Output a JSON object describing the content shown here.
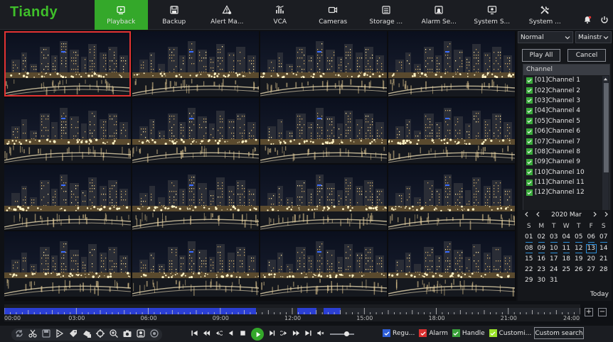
{
  "brand": {
    "logo": "Tiandy",
    "accent": "#34a82a",
    "logo_color": "#3fbf2a"
  },
  "nav": [
    {
      "label": "Playback",
      "icon": "playback-icon",
      "active": true
    },
    {
      "label": "Backup",
      "icon": "backup-icon"
    },
    {
      "label": "Alert Ma...",
      "icon": "alert-icon"
    },
    {
      "label": "VCA",
      "icon": "vca-icon"
    },
    {
      "label": "Cameras",
      "icon": "camera-icon"
    },
    {
      "label": "Storage ...",
      "icon": "storage-icon"
    },
    {
      "label": "Alarm Se...",
      "icon": "alarm-icon"
    },
    {
      "label": "System S...",
      "icon": "system-status-icon"
    },
    {
      "label": "System ...",
      "icon": "system-settings-icon"
    }
  ],
  "grid": {
    "selected_color": "#e23232"
  },
  "panel": {
    "mode_select": "Normal",
    "stream_select": "Mainstr",
    "play_all_label": "Play All",
    "cancel_label": "Cancel",
    "channel_header": "Channel",
    "channels": [
      "[01]Channel 1",
      "[02]Channel 2",
      "[03]Channel 3",
      "[04]Channel 4",
      "[05]Channel 5",
      "[06]Channel 6",
      "[07]Channel 7",
      "[08]Channel 8",
      "[09]Channel 9",
      "[10]Channel 10",
      "[11]Channel 11",
      "[12]Channel 12"
    ]
  },
  "calendar": {
    "title": "2020 Mar",
    "weekdays": [
      "S",
      "M",
      "T",
      "W",
      "T",
      "F",
      "S"
    ],
    "days": [
      [
        "01",
        "02",
        "03",
        "04",
        "05",
        "06",
        "07"
      ],
      [
        "08",
        "09",
        "10",
        "11",
        "12",
        "13",
        "14"
      ],
      [
        "15",
        "16",
        "17",
        "18",
        "19",
        "20",
        "21"
      ],
      [
        "22",
        "23",
        "24",
        "25",
        "26",
        "27",
        "28"
      ],
      [
        "29",
        "30",
        "31",
        "",
        "",
        "",
        ""
      ]
    ],
    "recorded_days": [
      "01",
      "02",
      "03",
      "04",
      "05",
      "06",
      "07",
      "08",
      "09",
      "10",
      "11",
      "12",
      "13"
    ],
    "current_day": "13",
    "today_label": "Today"
  },
  "timeline": {
    "labels": [
      "00:00",
      "03:00",
      "06:00",
      "09:00",
      "12:00",
      "15:00",
      "18:00",
      "21:00",
      "24:00"
    ],
    "recorded_ranges_hours": [
      [
        0,
        10.5
      ],
      [
        12.2,
        13.0
      ],
      [
        13.3,
        14.0
      ]
    ],
    "segment_color": "#2b3fd4"
  },
  "bottombar": {
    "legend": [
      {
        "label": "Regu...",
        "color": "#2f5fd8"
      },
      {
        "label": "Alarm",
        "color": "#d93030"
      },
      {
        "label": "Handle",
        "color": "#39a03a"
      },
      {
        "label": "Customi...",
        "color": "#9be32a"
      }
    ],
    "custom_search_label": "Custom search"
  }
}
